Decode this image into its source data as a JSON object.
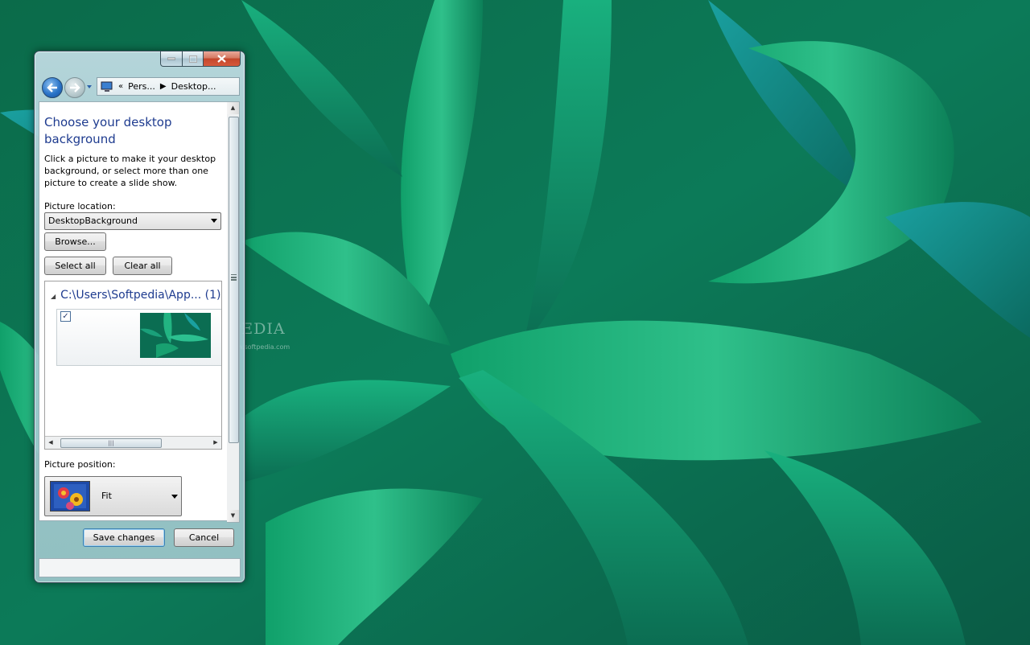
{
  "window": {
    "breadcrumb": [
      "Pers...",
      "Desktop..."
    ],
    "breadcrumb_prefix": "«"
  },
  "content": {
    "title": "Choose your desktop background",
    "description": "Click a picture to make it your desktop background, or select more than one picture to create a slide show.",
    "picture_location_label": "Picture location:",
    "picture_location_value": "DesktopBackground",
    "browse_label": "Browse...",
    "select_all_label": "Select all",
    "clear_all_label": "Clear all",
    "group_heading": "C:\\Users\\Softpedia\\App... (1)",
    "picture_checked": true,
    "picture_position_label": "Picture position:",
    "picture_position_value": "Fit"
  },
  "footer": {
    "save_label": "Save changes",
    "cancel_label": "Cancel"
  },
  "watermark": {
    "brand": "SOFTPEDIA",
    "url": "www.softpedia.com"
  },
  "colors": {
    "title_blue": "#1e3b8f",
    "desktop_green": "#0f8a5c",
    "close_red": "#c4462b"
  },
  "icons": [
    "back-arrow-icon",
    "forward-arrow-icon",
    "monitor-icon",
    "chevron-right-icon",
    "dropdown-arrow-icon",
    "checkmark-icon",
    "picture-position-icon"
  ]
}
